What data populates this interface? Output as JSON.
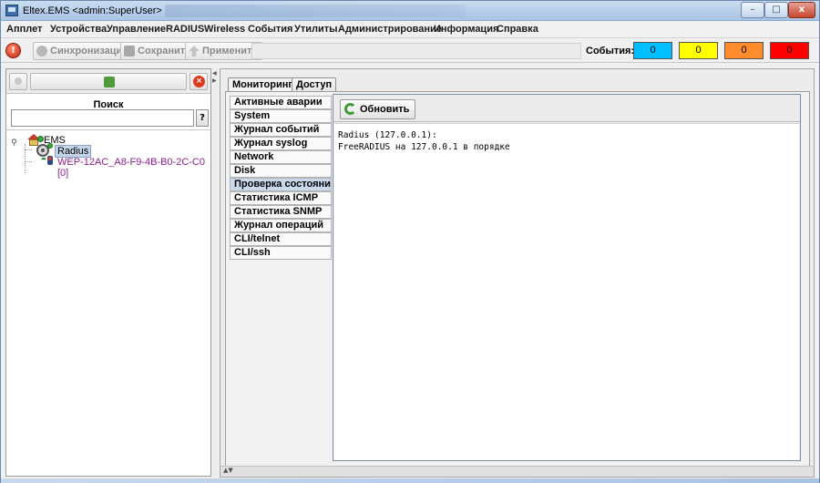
{
  "window": {
    "title": "Eltex.EMS <admin:SuperUser>",
    "controls": {
      "minimize": "–",
      "maximize": "□",
      "close": "x"
    }
  },
  "menu": [
    "Апплет",
    "Устройства",
    "Управление",
    "RADIUS",
    "Wireless",
    "События",
    "Утилиты",
    "Администрирование",
    "Информация",
    "Справка"
  ],
  "toolbar": {
    "sync_label": "Синхронизация",
    "save_label": "Сохранить",
    "apply_label": "Применить",
    "events_label": "События:",
    "events": [
      {
        "value": "0",
        "color": "#00bfff"
      },
      {
        "value": "0",
        "color": "#ffff00"
      },
      {
        "value": "0",
        "color": "#ff8c2a"
      },
      {
        "value": "0",
        "color": "#ff0000"
      }
    ]
  },
  "left_panel": {
    "search_label": "Поиск",
    "search_value": "",
    "search_button": "?",
    "tree": {
      "root": "EMS",
      "children": [
        "Radius",
        "WEP-12AC_A8-F9-4B-B0-2C-C0 [0]"
      ]
    }
  },
  "tabs": [
    {
      "label": "Мониторинг",
      "active": true
    },
    {
      "label": "Доступ",
      "active": false
    }
  ],
  "side_menu": [
    "Активные аварии",
    "System",
    "Журнал событий",
    "Журнал syslog",
    "Network",
    "Disk",
    "Проверка состояния",
    "Статистика ICMP",
    "Статистика SNMP",
    "Журнал операций",
    "CLI/telnet",
    "CLI/ssh"
  ],
  "selected_side_item": "Проверка состояния",
  "content": {
    "refresh_label": "Обновить",
    "output_lines": [
      "Radius (127.0.0.1):",
      "FreeRADIUS на 127.0.0.1 в порядке"
    ]
  }
}
